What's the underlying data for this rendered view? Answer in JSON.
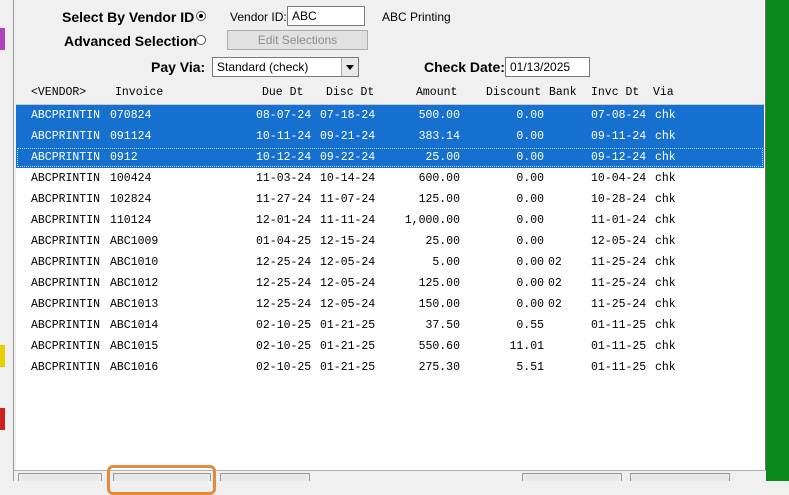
{
  "selection": {
    "by_vendor_label": "Select By Vendor ID",
    "by_vendor_checked": true,
    "advanced_label": "Advanced Selection",
    "advanced_checked": false,
    "vendor_id_label": "Vendor ID:",
    "vendor_id_value": "ABC",
    "vendor_name": "ABC Printing",
    "edit_selections_label": "Edit Selections"
  },
  "payment": {
    "pay_via_label": "Pay Via:",
    "pay_via_value": "Standard (check)",
    "check_date_label": "Check Date:",
    "check_date_value": "01/13/2025"
  },
  "grid": {
    "columns": {
      "vendor": "<VENDOR>",
      "invoice": "Invoice",
      "due_dt": "Due Dt",
      "disc_dt": "Disc Dt",
      "amount": "Amount",
      "discount": "Discount",
      "bank": "Bank",
      "invc_dt": "Invc Dt",
      "via": "Via"
    },
    "rows": [
      {
        "vendor": "ABCPRINTIN",
        "invoice": "070824",
        "due": "08-07-24",
        "disc": "07-18-24",
        "amount": "500.00",
        "discount": "0.00",
        "bank": "",
        "invc": "07-08-24",
        "via": "chk",
        "selected": true
      },
      {
        "vendor": "ABCPRINTIN",
        "invoice": "091124",
        "due": "10-11-24",
        "disc": "09-21-24",
        "amount": "383.14",
        "discount": "0.00",
        "bank": "",
        "invc": "09-11-24",
        "via": "chk",
        "selected": true
      },
      {
        "vendor": "ABCPRINTIN",
        "invoice": "0912",
        "due": "10-12-24",
        "disc": "09-22-24",
        "amount": "25.00",
        "discount": "0.00",
        "bank": "",
        "invc": "09-12-24",
        "via": "chk",
        "selected": true
      },
      {
        "vendor": "ABCPRINTIN",
        "invoice": "100424",
        "due": "11-03-24",
        "disc": "10-14-24",
        "amount": "600.00",
        "discount": "0.00",
        "bank": "",
        "invc": "10-04-24",
        "via": "chk",
        "selected": false
      },
      {
        "vendor": "ABCPRINTIN",
        "invoice": "102824",
        "due": "11-27-24",
        "disc": "11-07-24",
        "amount": "125.00",
        "discount": "0.00",
        "bank": "",
        "invc": "10-28-24",
        "via": "chk",
        "selected": false
      },
      {
        "vendor": "ABCPRINTIN",
        "invoice": "110124",
        "due": "12-01-24",
        "disc": "11-11-24",
        "amount": "1,000.00",
        "discount": "0.00",
        "bank": "",
        "invc": "11-01-24",
        "via": "chk",
        "selected": false
      },
      {
        "vendor": "ABCPRINTIN",
        "invoice": "ABC1009",
        "due": "01-04-25",
        "disc": "12-15-24",
        "amount": "25.00",
        "discount": "0.00",
        "bank": "",
        "invc": "12-05-24",
        "via": "chk",
        "selected": false
      },
      {
        "vendor": "ABCPRINTIN",
        "invoice": "ABC1010",
        "due": "12-25-24",
        "disc": "12-05-24",
        "amount": "5.00",
        "discount": "0.00",
        "bank": "02",
        "invc": "11-25-24",
        "via": "chk",
        "selected": false
      },
      {
        "vendor": "ABCPRINTIN",
        "invoice": "ABC1012",
        "due": "12-25-24",
        "disc": "12-05-24",
        "amount": "125.00",
        "discount": "0.00",
        "bank": "02",
        "invc": "11-25-24",
        "via": "chk",
        "selected": false
      },
      {
        "vendor": "ABCPRINTIN",
        "invoice": "ABC1013",
        "due": "12-25-24",
        "disc": "12-05-24",
        "amount": "150.00",
        "discount": "0.00",
        "bank": "02",
        "invc": "11-25-24",
        "via": "chk",
        "selected": false
      },
      {
        "vendor": "ABCPRINTIN",
        "invoice": "ABC1014",
        "due": "02-10-25",
        "disc": "01-21-25",
        "amount": "37.50",
        "discount": "0.55",
        "bank": "",
        "invc": "01-11-25",
        "via": "chk",
        "selected": false
      },
      {
        "vendor": "ABCPRINTIN",
        "invoice": "ABC1015",
        "due": "02-10-25",
        "disc": "01-21-25",
        "amount": "550.60",
        "discount": "11.01",
        "bank": "",
        "invc": "01-11-25",
        "via": "chk",
        "selected": false
      },
      {
        "vendor": "ABCPRINTIN",
        "invoice": "ABC1016",
        "due": "02-10-25",
        "disc": "01-21-25",
        "amount": "275.30",
        "discount": "5.51",
        "bank": "",
        "invc": "01-11-25",
        "via": "chk",
        "selected": false
      }
    ]
  },
  "colors": {
    "selection_blue": "#1570d0",
    "frame_green": "#0a8a1a",
    "highlight_orange": "#e58a3c"
  }
}
